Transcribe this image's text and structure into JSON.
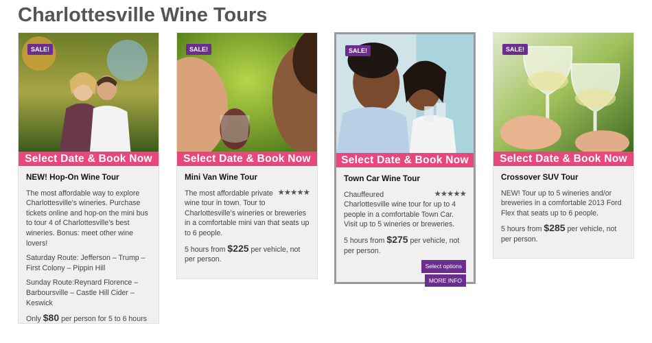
{
  "page": {
    "title": "Charlottesville Wine Tours"
  },
  "cards": [
    {
      "badge": "SALE!",
      "button": "Select Date & Book Now",
      "title": "NEW! Hop-On Wine Tour",
      "description": "The most affordable way to explore Charlottesville’s wineries. Purchase tickets online and hop-on the mini bus to tour 4 of Charlottesville’s best wineries. Bonus: meet other wine lovers!",
      "route_saturday": "Saturday Route: Jefferson – Trump – First Colony – Pippin Hill",
      "route_sunday": "Sunday Route:Reynard Florence – Barboursville – Castle Hill Cider – Keswick",
      "price_prefix": "Only",
      "price": "$80",
      "price_suffix": "per person for 5 to 6 hours"
    },
    {
      "badge": "SALE!",
      "button": "Select Date & Book Now",
      "title": "Mini Van Wine Tour",
      "stars": "★★★★★",
      "description": "The most affordable private wine tour in town. Tour to Charlottesville’s wineries or breweries in a comfortable mini van that seats up to 6 people.",
      "price_prefix": "5 hours from",
      "price": "$225",
      "price_suffix": "per vehicle, not per person."
    },
    {
      "badge": "SALE!",
      "button": "Select Date & Book Now",
      "title": "Town Car Wine Tour",
      "stars": "★★★★★",
      "description": "Chauffeured Charlottesville wine tour for up to 4 people in a comfortable Town Car. Visit up to 5 wineries or breweries.",
      "price_prefix": "5 hours from",
      "price": "$275",
      "price_suffix": "per vehicle, not per person.",
      "select_options": "Select options",
      "more_info": "MORE INFO"
    },
    {
      "badge": "SALE!",
      "button": "Select Date & Book Now",
      "title": "Crossover SUV Tour",
      "description": "NEW! Tour up to 5 wineries and/or breweries in a comfortable 2013 Ford Flex that seats up to 6 people.",
      "price_prefix": "5 hours from",
      "price": "$285",
      "price_suffix": "per vehicle, not per person."
    }
  ],
  "colors": {
    "book_button": "#e8477d",
    "badge": "#6b2e8f",
    "card_bg": "#f0f0f0"
  }
}
